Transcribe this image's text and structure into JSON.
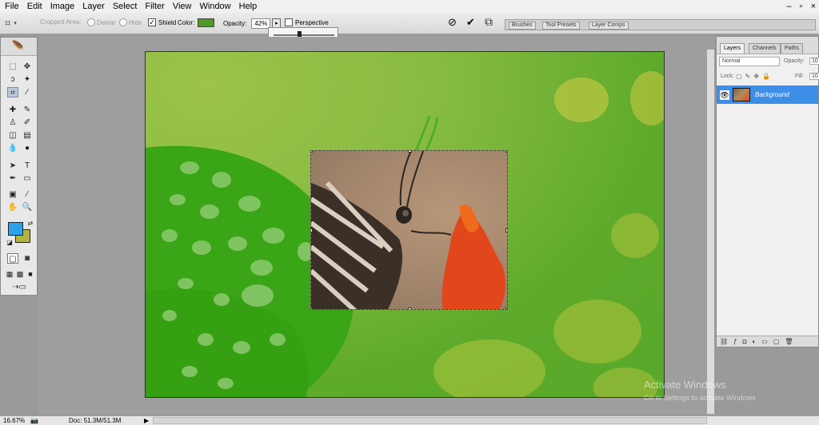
{
  "menubar": {
    "items": [
      "File",
      "Edit",
      "Image",
      "Layer",
      "Select",
      "Filter",
      "View",
      "Window",
      "Help"
    ],
    "window_controls": [
      "–",
      "▫",
      "×"
    ]
  },
  "options": {
    "cropped_area_label": "Cropped Area:",
    "delete_label": "Delete",
    "hide_label": "Hide",
    "shield_label": "Shield",
    "color_label": "Color:",
    "shield_color": "#4e9a23",
    "opacity_label": "Opacity:",
    "opacity_value": "42%",
    "perspective_label": "Perspective",
    "cancel_symbol": "⃠",
    "commit_symbol": "✔",
    "opacity_slider_level": 0.42
  },
  "wells": {
    "tabs": [
      "Brushes",
      "Tool Presets",
      "Layer Comps"
    ]
  },
  "layers_panel": {
    "tabs": [
      "Layers",
      "Channels",
      "Paths"
    ],
    "blend_mode": "Normal",
    "opacity_label": "Opacity:",
    "opacity_value": "10",
    "lock_label": "Lock:",
    "fill_label": "Fill:",
    "fill_value": "10",
    "layer_name": "Background"
  },
  "colors": {
    "foreground": "#2aa3ef",
    "background": "#b3b53e",
    "selection": "#3d8ee6"
  },
  "status": {
    "zoom": "16.67%",
    "doc_info": "Doc: 51.3M/51.3M"
  },
  "watermark": {
    "line1": "Activate Windows",
    "line2": "Go to Settings to activate Windows"
  }
}
